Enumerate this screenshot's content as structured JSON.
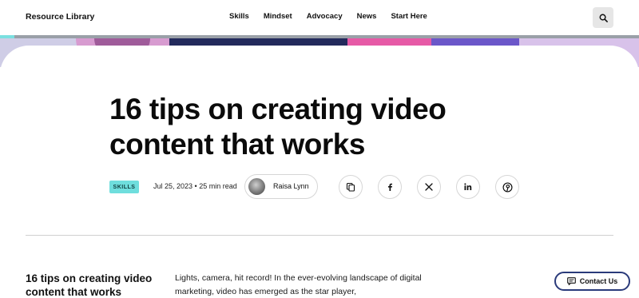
{
  "header": {
    "brand": "Resource Library",
    "nav": [
      "Skills",
      "Mindset",
      "Advocacy",
      "News",
      "Start Here"
    ],
    "search_icon": "search-icon"
  },
  "article": {
    "title": "16 tips on creating video content that works",
    "category_badge": "SKILLS",
    "date_readtime": "Jul 25, 2023 • 25 min read",
    "author": "Raisa Lynn",
    "share_icons": [
      "copy-icon",
      "facebook-icon",
      "x-icon",
      "linkedin-icon",
      "pinterest-icon"
    ],
    "sidebar_title": "16 tips on creating video content that works",
    "intro": "Lights, camera, hit record! In the ever-evolving landscape of digital marketing, video has emerged as the star player,"
  },
  "contact": {
    "label": "Contact Us"
  },
  "colors": {
    "badge": "#6fdedd",
    "contact_border": "#2a3a7a"
  }
}
